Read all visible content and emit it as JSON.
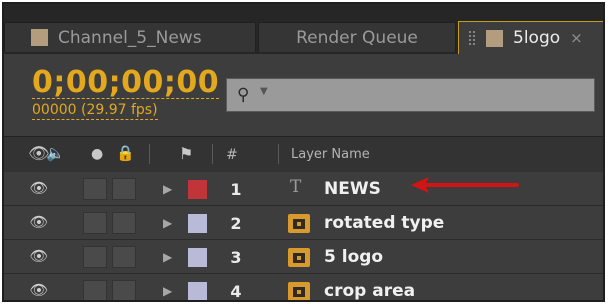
{
  "tabs": [
    {
      "label": "Channel_5_News",
      "swatch": "#b49c7f",
      "active": false
    },
    {
      "label": "Render Queue",
      "active": false
    },
    {
      "label": "5logo",
      "swatch": "#b49c7f",
      "active": true,
      "close": "×"
    }
  ],
  "timecode": "0;00;00;00",
  "fps_label": "00000 (29.97 fps)",
  "search": {
    "placeholder": "",
    "icon": "search-icon"
  },
  "header": {
    "number_label": "#",
    "layer_name_label": "Layer Name"
  },
  "layers": [
    {
      "number": "1",
      "name": "NEWS",
      "type": "text",
      "type_glyph": "T",
      "label_color": "#c1343a"
    },
    {
      "number": "2",
      "name": "rotated type",
      "type": "comp",
      "label_color": "#b9b9d8"
    },
    {
      "number": "3",
      "name": "5 logo",
      "type": "comp",
      "label_color": "#b9b9d8"
    },
    {
      "number": "4",
      "name": "crop area",
      "type": "comp",
      "label_color": "#b9b9d8"
    }
  ],
  "colors": {
    "accent": "#e3a81d",
    "arrow": "#d21414",
    "panel": "#2b2b2b"
  }
}
